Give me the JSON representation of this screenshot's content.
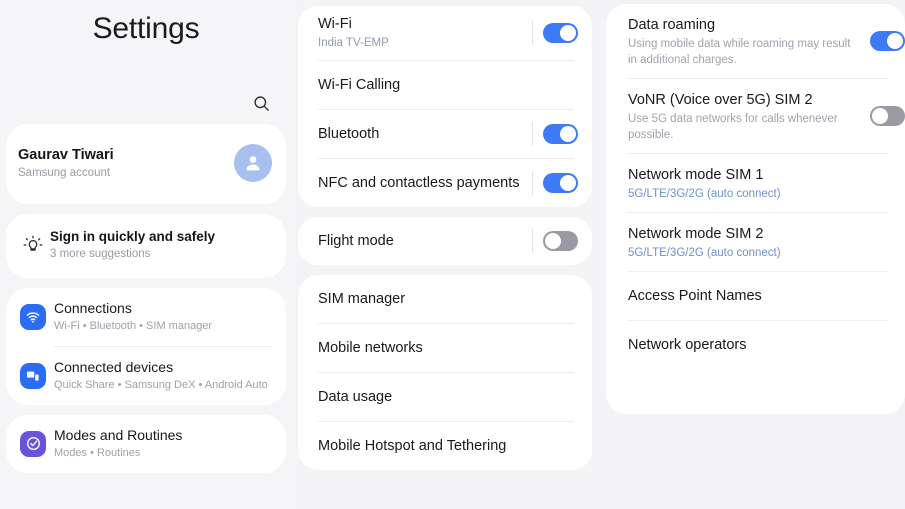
{
  "app": {
    "title": "Settings",
    "accent_blue": "#3d7af5",
    "link_blue": "#6f8fd0",
    "card_bg": "#ffffff",
    "page_bg": "#f5f5f8"
  },
  "sidebar": {
    "title": "Settings",
    "search_icon": "search-icon",
    "account": {
      "name": "Gaurav Tiwari",
      "subtitle": "Samsung account",
      "avatar_icon": "person-icon"
    },
    "suggestion": {
      "icon": "lightbulb-icon",
      "title": "Sign in quickly and safely",
      "subtitle": "3 more suggestions"
    },
    "items": [
      {
        "label": "Connections",
        "subtitle": "Wi-Fi  •  Bluetooth  •  SIM manager",
        "icon": "wifi-icon",
        "icon_bg": "#2a6df4"
      },
      {
        "label": "Connected devices",
        "subtitle": "Quick Share  •  Samsung DeX  •  Android Auto",
        "icon": "devices-icon",
        "icon_bg": "#2a6df4"
      },
      {
        "label": "Modes and Routines",
        "subtitle": "Modes  •  Routines",
        "icon": "check-circle-icon",
        "icon_bg": "#6a53d8"
      }
    ]
  },
  "middle": {
    "group1": [
      {
        "label": "Wi-Fi",
        "subtitle": "India TV-EMP",
        "toggle": "on"
      },
      {
        "label": "Wi-Fi Calling",
        "subtitle": "",
        "toggle": "none"
      },
      {
        "label": "Bluetooth",
        "subtitle": "",
        "toggle": "on"
      },
      {
        "label": "NFC and contactless payments",
        "subtitle": "",
        "toggle": "on"
      }
    ],
    "group2": [
      {
        "label": "Flight mode",
        "subtitle": "",
        "toggle": "off"
      }
    ],
    "group3": [
      {
        "label": "SIM manager",
        "subtitle": "",
        "toggle": "none"
      },
      {
        "label": "Mobile networks",
        "subtitle": "",
        "toggle": "none"
      },
      {
        "label": "Data usage",
        "subtitle": "",
        "toggle": "none"
      },
      {
        "label": "Mobile Hotspot and Tethering",
        "subtitle": "",
        "toggle": "none"
      }
    ]
  },
  "right": {
    "items": [
      {
        "label": "Data roaming",
        "subtitle": "Using mobile data while roaming may result in additional charges.",
        "subtitle_style": "gray",
        "toggle": "on"
      },
      {
        "label": "VoNR (Voice over 5G) SIM 2",
        "subtitle": "Use 5G data networks for calls whenever possible.",
        "subtitle_style": "gray",
        "toggle": "off"
      },
      {
        "label": "Network mode SIM 1",
        "subtitle": "5G/LTE/3G/2G (auto connect)",
        "subtitle_style": "blue",
        "toggle": "none"
      },
      {
        "label": "Network mode SIM 2",
        "subtitle": "5G/LTE/3G/2G (auto connect)",
        "subtitle_style": "blue",
        "toggle": "none"
      },
      {
        "label": "Access Point Names",
        "subtitle": "",
        "subtitle_style": "gray",
        "toggle": "none"
      },
      {
        "label": "Network operators",
        "subtitle": "",
        "subtitle_style": "gray",
        "toggle": "none"
      }
    ]
  }
}
